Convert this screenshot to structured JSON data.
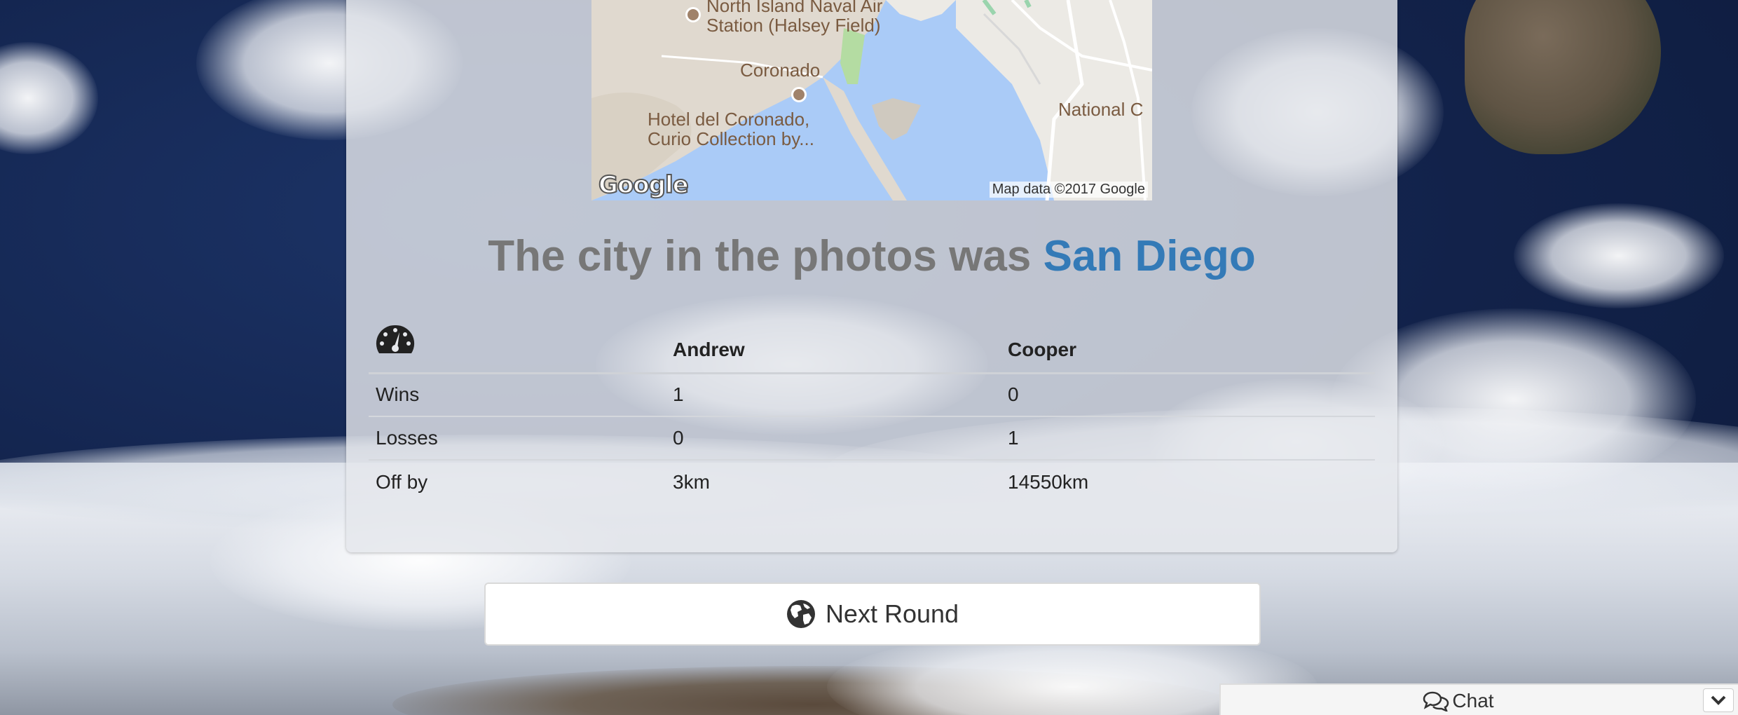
{
  "map": {
    "labels": {
      "naval_air": "North Island Naval Air\nStation (Halsey Field)",
      "coronado": "Coronado",
      "hotel": "Hotel del Coronado,\nCurio Collection by...",
      "national": "National C"
    },
    "logo": "Google",
    "attribution": "Map data ©2017 Google"
  },
  "result": {
    "prefix": "The city in the photos was ",
    "city": "San Diego"
  },
  "scoreboard": {
    "header_icon": "dashboard-icon",
    "players": [
      "Andrew",
      "Cooper"
    ],
    "rows": [
      {
        "label": "Wins",
        "values": [
          "1",
          "0"
        ]
      },
      {
        "label": "Losses",
        "values": [
          "0",
          "1"
        ]
      },
      {
        "label": "Off by",
        "values": [
          "3km",
          "14550km"
        ]
      }
    ]
  },
  "next_round": {
    "icon": "globe-icon",
    "label": "Next Round"
  },
  "chat": {
    "icon": "chat-bubbles-icon",
    "label": "Chat",
    "toggle_icon": "chevron-down-icon"
  },
  "colors": {
    "city_link": "#337ab7",
    "result_text": "#777777",
    "map_water": "#aacbf7",
    "map_land": "#e0d9cf"
  }
}
